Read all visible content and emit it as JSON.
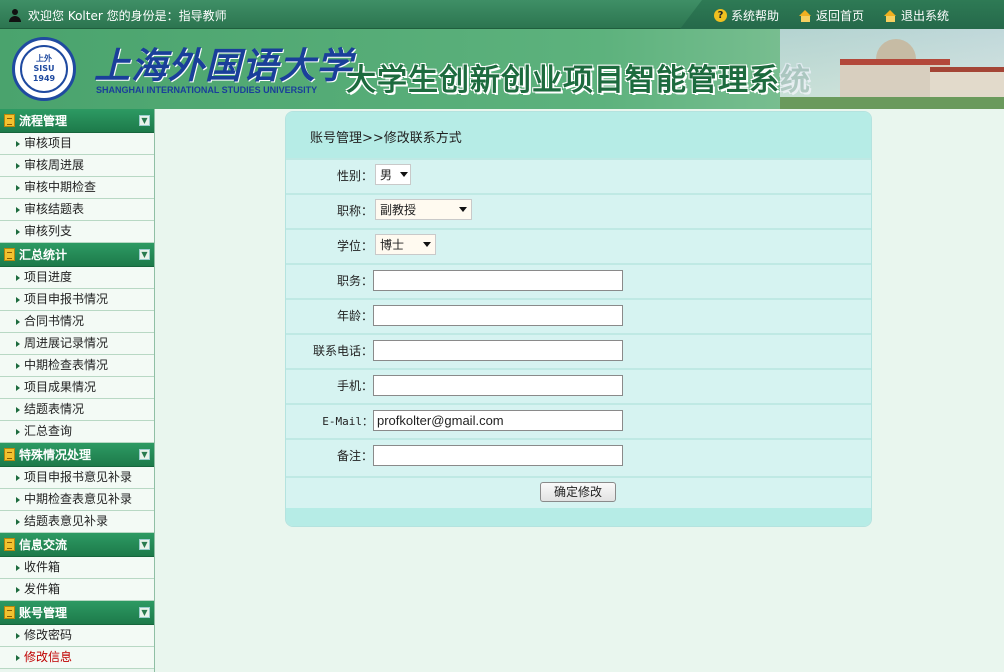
{
  "topbar": {
    "welcome": "欢迎您 Kolter 您的身份是：指导教师",
    "links": {
      "help": "系统帮助",
      "home": "返回首页",
      "logout": "退出系统"
    }
  },
  "banner": {
    "seal_top": "上外",
    "seal_mid": "SISU",
    "seal_year": "1949",
    "university_cn": "上海外国语大学",
    "university_en": "SHANGHAI INTERNATIONAL STUDIES UNIVERSITY",
    "system_title": "大学生创新创业项目智能管理系统"
  },
  "sidebar": {
    "groups": [
      {
        "title": "流程管理",
        "items": [
          "审核项目",
          "审核周进展",
          "审核中期检查",
          "审核结题表",
          "审核列支"
        ]
      },
      {
        "title": "汇总统计",
        "items": [
          "项目进度",
          "项目申报书情况",
          "合同书情况",
          "周进展记录情况",
          "中期检查表情况",
          "项目成果情况",
          "结题表情况",
          "汇总查询"
        ]
      },
      {
        "title": "特殊情况处理",
        "items": [
          "项目申报书意见补录",
          "中期检查表意见补录",
          "结题表意见补录"
        ]
      },
      {
        "title": "信息交流",
        "items": [
          "收件箱",
          "发件箱"
        ]
      },
      {
        "title": "账号管理",
        "items": [
          "修改密码",
          "修改信息"
        ]
      }
    ],
    "active_item": "修改信息"
  },
  "panel": {
    "breadcrumb": "账号管理>>修改联系方式",
    "fields": {
      "gender": {
        "label": "性别：",
        "value": "男"
      },
      "title": {
        "label": "职称：",
        "value": "副教授"
      },
      "degree": {
        "label": "学位：",
        "value": "博士"
      },
      "position": {
        "label": "职务：",
        "value": ""
      },
      "age": {
        "label": "年龄：",
        "value": ""
      },
      "phone": {
        "label": "联系电话：",
        "value": ""
      },
      "mobile": {
        "label": "手机：",
        "value": ""
      },
      "email": {
        "label": "E-Mail：",
        "value": "profkolter@gmail.com"
      },
      "remark": {
        "label": "备注：",
        "value": ""
      }
    },
    "submit_label": "确定修改"
  },
  "colors": {
    "header_green": "#2c7550",
    "banner_green": "#4aa36d",
    "sidebar_head": "#1d7a4a",
    "panel_bg": "#d6f3f1",
    "panel_head": "#b6ece6",
    "active_link": "#c00000"
  }
}
